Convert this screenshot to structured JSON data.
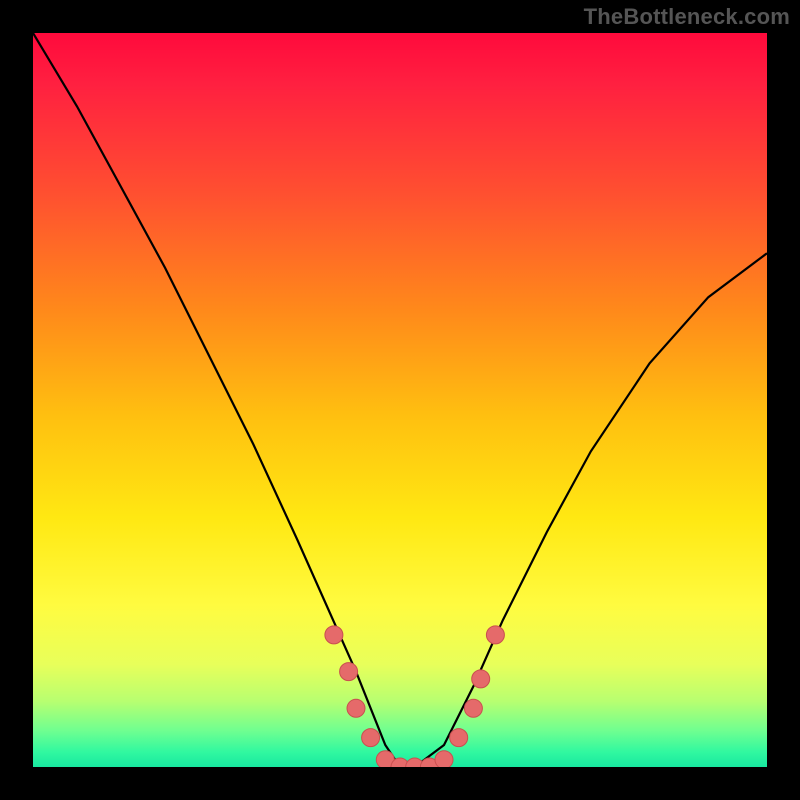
{
  "watermark": {
    "text": "TheBottleneck.com"
  },
  "chart_data": {
    "type": "line",
    "title": "",
    "xlabel": "",
    "ylabel": "",
    "xlim": [
      0,
      100
    ],
    "ylim": [
      0,
      100
    ],
    "grid": false,
    "legend": false,
    "background_gradient": {
      "direction": "vertical",
      "stops": [
        {
          "pos": 0.0,
          "color": "#ff0a3c"
        },
        {
          "pos": 0.22,
          "color": "#ff5030"
        },
        {
          "pos": 0.52,
          "color": "#ffbf10"
        },
        {
          "pos": 0.78,
          "color": "#fffb40"
        },
        {
          "pos": 0.95,
          "color": "#70ff90"
        },
        {
          "pos": 1.0,
          "color": "#18e8a0"
        }
      ]
    },
    "series": [
      {
        "name": "bottleneck-curve",
        "x": [
          0,
          6,
          12,
          18,
          24,
          30,
          36,
          40,
          44,
          48,
          50,
          52,
          56,
          60,
          64,
          70,
          76,
          84,
          92,
          100
        ],
        "y": [
          100,
          90,
          79,
          68,
          56,
          44,
          31,
          22,
          13,
          3,
          0,
          0,
          3,
          11,
          20,
          32,
          43,
          55,
          64,
          70
        ]
      }
    ],
    "markers": {
      "name": "highlight-points",
      "color": "#e56a6a",
      "points": [
        {
          "x": 41,
          "y": 18
        },
        {
          "x": 43,
          "y": 13
        },
        {
          "x": 44,
          "y": 8
        },
        {
          "x": 46,
          "y": 4
        },
        {
          "x": 48,
          "y": 1
        },
        {
          "x": 50,
          "y": 0
        },
        {
          "x": 52,
          "y": 0
        },
        {
          "x": 54,
          "y": 0
        },
        {
          "x": 56,
          "y": 1
        },
        {
          "x": 58,
          "y": 4
        },
        {
          "x": 60,
          "y": 8
        },
        {
          "x": 61,
          "y": 12
        },
        {
          "x": 63,
          "y": 18
        }
      ]
    }
  }
}
